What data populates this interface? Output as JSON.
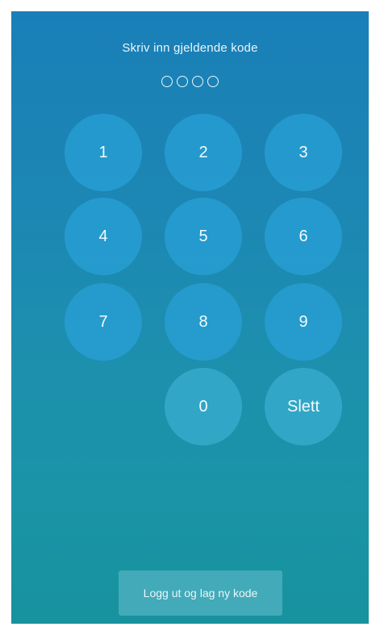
{
  "pin_screen": {
    "prompt": "Skriv inn gjeldende kode",
    "pin_length": 4,
    "entered_digits": 0
  },
  "keypad": {
    "keys": [
      "1",
      "2",
      "3",
      "4",
      "5",
      "6",
      "7",
      "8",
      "9",
      "0"
    ],
    "delete_label": "Slett"
  },
  "logout_button": {
    "label": "Logg ut og lag ny kode"
  },
  "colors": {
    "background_top": "#1a7fb8",
    "background_bottom": "#17929e",
    "key_fill": "#28a0d7",
    "text": "#eaf6fb"
  }
}
